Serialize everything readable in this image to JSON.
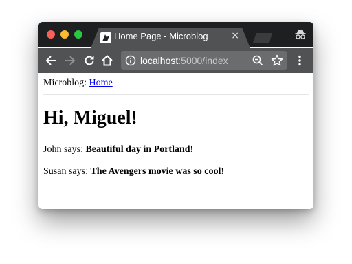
{
  "browser": {
    "tab": {
      "title": "Home Page - Microblog",
      "close_glyph": "×",
      "favicon": "microblog-favicon"
    },
    "omnibox": {
      "host": "localhost",
      "path": ":5000/index"
    },
    "icons": {
      "back": "arrow-left-icon",
      "forward": "arrow-right-icon",
      "reload": "reload-icon",
      "home": "home-icon",
      "info": "info-icon",
      "zoom": "magnifier-icon",
      "bookmark": "star-icon",
      "menu": "kebab-menu-icon",
      "incognito": "incognito-icon"
    },
    "colors": {
      "tabbar": "#1e1f21",
      "toolbar": "#515254",
      "omnibox": "#6b6c6e",
      "close": "#fc5f57",
      "minimize": "#fdbc2e",
      "maximize": "#28c840"
    }
  },
  "page": {
    "nav": {
      "brand": "Microblog:",
      "home_link": "Home",
      "link_color": "#0000ee"
    },
    "greeting": "Hi, Miguel!",
    "posts": [
      {
        "author": "John",
        "says": " says: ",
        "body": "Beautiful day in Portland!"
      },
      {
        "author": "Susan",
        "says": " says: ",
        "body": "The Avengers movie was so cool!"
      }
    ]
  }
}
